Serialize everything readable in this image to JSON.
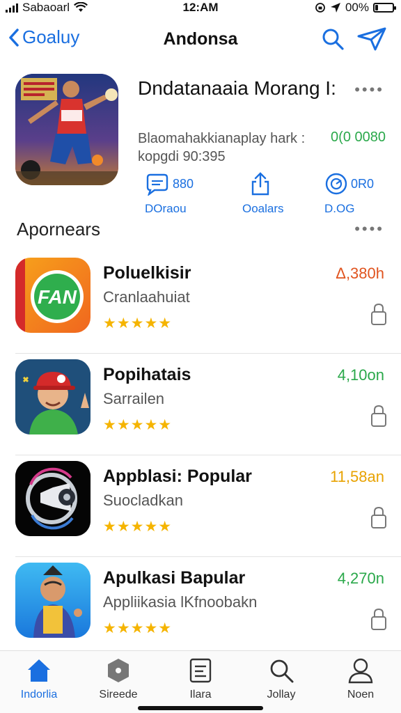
{
  "status": {
    "carrier": "Sabaoarl",
    "time": "12:AM",
    "battery": "00%",
    "battery_level": 0.15
  },
  "nav": {
    "back_label": "Goaluy",
    "title": "Andonsa"
  },
  "feature": {
    "title": "Dndatanaaia Morang I:",
    "description": "Blaomahakkianaplay hark : kopgdi 90:395",
    "price": "0(0 0080",
    "more": "••••",
    "actions": [
      {
        "value": "880",
        "label": "DOraou"
      },
      {
        "value": "",
        "label": "Ooalars"
      },
      {
        "value": "0R0",
        "label": "D.OG"
      }
    ]
  },
  "section": {
    "title": "Apornears",
    "more": "••••"
  },
  "apps": [
    {
      "name": "Poluelkisir",
      "subtitle": "Cranlaahuiat",
      "stars": "★★★★★",
      "price": "Δ,380h",
      "price_color": "#e0541f"
    },
    {
      "name": "Popihatais",
      "subtitle": "Sarrailen",
      "stars": "★★★★★",
      "price": "4,10on",
      "price_color": "#2aa84a"
    },
    {
      "name": "Appblasi: Popular",
      "subtitle": "Suocladkan",
      "stars": "★★★★★",
      "price": "11,58an",
      "price_color": "#e8a200"
    },
    {
      "name": "Apulkasi Bapular",
      "subtitle": "Appliikasia lKfnoobakn",
      "stars": "★★★★★",
      "price": "4,270n",
      "price_color": "#2aa84a"
    }
  ],
  "tabs": [
    {
      "label": "Indorlia",
      "icon": "house-icon",
      "active": true
    },
    {
      "label": "Sireede",
      "icon": "hexagon-icon",
      "active": false
    },
    {
      "label": "Ilara",
      "icon": "list-box-icon",
      "active": false
    },
    {
      "label": "Jollay",
      "icon": "search-icon",
      "active": false
    },
    {
      "label": "Noen",
      "icon": "person-icon",
      "active": false
    }
  ],
  "colors": {
    "accent": "#1a6fe0",
    "star": "#f5b400",
    "green": "#2aa84a"
  }
}
